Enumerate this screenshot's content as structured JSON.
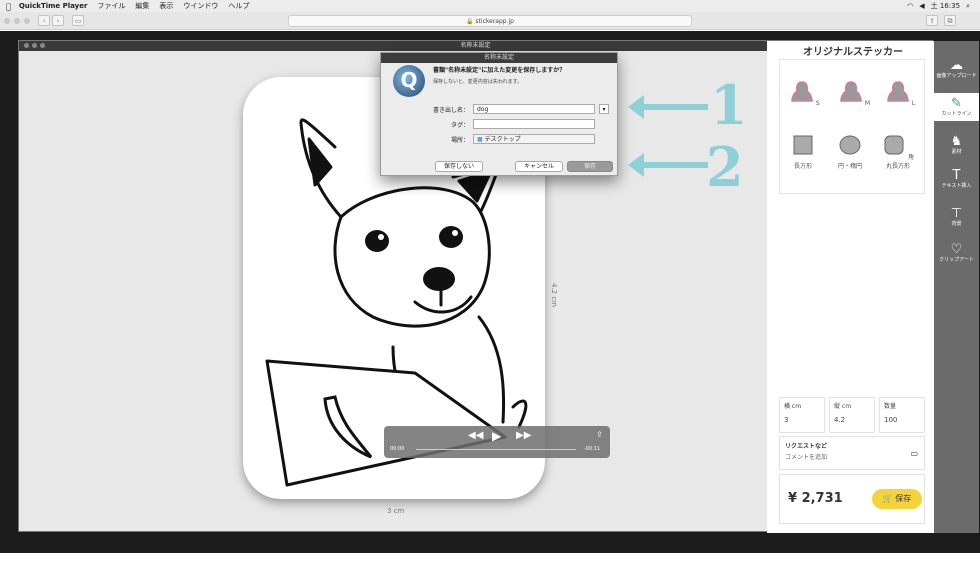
{
  "menubar": {
    "app": "QuickTime Player",
    "items": [
      "ファイル",
      "編集",
      "表示",
      "ウインドウ",
      "ヘルプ"
    ],
    "clock": "土 16:35"
  },
  "browser": {
    "url": "stickerapp.jp"
  },
  "window": {
    "title": "名称未設定"
  },
  "canvas": {
    "width_label": "3 cm",
    "height_label": "4.2 cm"
  },
  "panel": {
    "title": "オリジナルステッカー",
    "sizes": [
      "S",
      "M",
      "L"
    ],
    "shapes": [
      "長方形",
      "円・楕円",
      "角丸長方形"
    ],
    "props": [
      {
        "label": "横 cm",
        "value": "3"
      },
      {
        "label": "縦 cm",
        "value": "4.2"
      },
      {
        "label": "数量",
        "value": "100"
      }
    ],
    "request_title": "リクエストなど",
    "request_sub": "コメントを追加",
    "price": "¥ 2,731",
    "save": "保存"
  },
  "sidebar": [
    {
      "label": "画像アップロード",
      "icon": "cloud-upload-icon"
    },
    {
      "label": "カットライン",
      "icon": "pencil-icon"
    },
    {
      "label": "素材",
      "icon": "dog-icon"
    },
    {
      "label": "テキスト挿入",
      "icon": "text-icon"
    },
    {
      "label": "背景",
      "icon": "paint-roller-icon"
    },
    {
      "label": "クリップアート",
      "icon": "heart-icon"
    }
  ],
  "dialog": {
    "title": "名称未設定",
    "message": "書類\"名称未設定\"に加えた変更を保存しますか？",
    "sub": "保存しないと、変更内容は失われます。",
    "export_label": "書き出し名：",
    "export_value": "dog",
    "tag_label": "タグ：",
    "place_label": "場所：",
    "place_value": "デスクトップ",
    "btn_dont_save": "保存しない",
    "btn_cancel": "キャンセル",
    "btn_save": "保存"
  },
  "player": {
    "elapsed": "00:00",
    "remaining": "-00:11"
  },
  "annotations": [
    "1",
    "2"
  ],
  "colors": {
    "annotation": "#8dd0d6",
    "accent_yellow": "#f5d33a",
    "sidebar": "#6b6b6b"
  }
}
